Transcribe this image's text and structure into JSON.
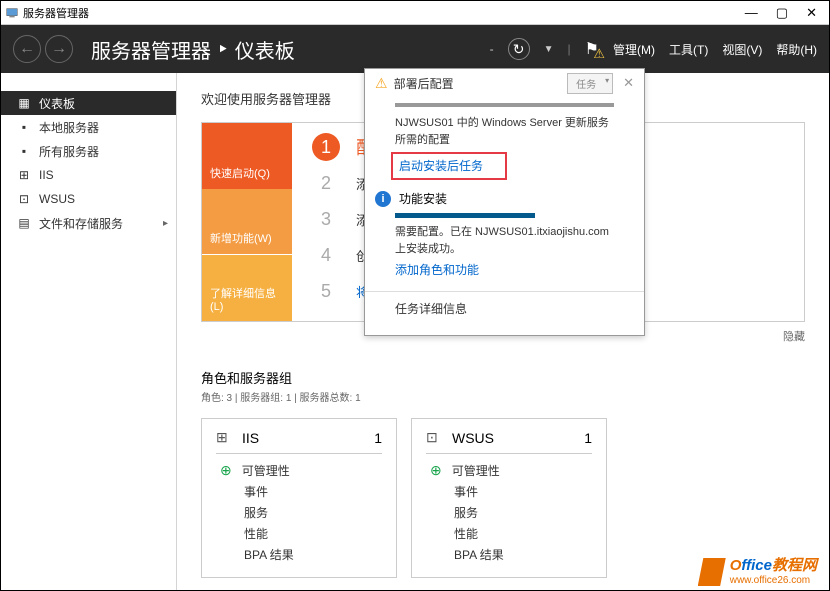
{
  "window": {
    "title": "服务器管理器"
  },
  "header": {
    "title_main": "服务器管理器",
    "title_sep": "‣",
    "title_sub": "仪表板",
    "menu": {
      "manage": "管理(M)",
      "tools": "工具(T)",
      "view": "视图(V)",
      "help": "帮助(H)"
    }
  },
  "sidebar": {
    "items": [
      {
        "icon": "dashboard",
        "label": "仪表板"
      },
      {
        "icon": "server",
        "label": "本地服务器"
      },
      {
        "icon": "servers",
        "label": "所有服务器"
      },
      {
        "icon": "iis",
        "label": "IIS"
      },
      {
        "icon": "wsus",
        "label": "WSUS"
      },
      {
        "icon": "files",
        "label": "文件和存储服务"
      }
    ]
  },
  "content": {
    "welcome": "欢迎使用服务器管理器",
    "qs_tabs": {
      "quick": "快速启动(Q)",
      "new": "新增功能(W)",
      "learn": "了解详细信息(L)"
    },
    "steps": {
      "s1": "配",
      "s2": "添",
      "s3": "添",
      "s4": "创",
      "s5": "将此服务器连接到云服务"
    },
    "hide": "隐藏",
    "roles_title": "角色和服务器组",
    "roles_sub": "角色: 3 | 服务器组: 1 | 服务器总数: 1"
  },
  "tiles": [
    {
      "name": "IIS",
      "count": "1",
      "rows": [
        "可管理性",
        "事件",
        "服务",
        "性能",
        "BPA 结果"
      ]
    },
    {
      "name": "WSUS",
      "count": "1",
      "rows": [
        "可管理性",
        "事件",
        "服务",
        "性能",
        "BPA 结果"
      ]
    }
  ],
  "notif": {
    "title": "部署后配置",
    "task_label": "任务",
    "desc": "NJWSUS01 中的 Windows Server 更新服务 所需的配置",
    "link1": "启动安装后任务",
    "install_title": "功能安装",
    "install_desc": "需要配置。已在 NJWSUS01.itxiaojishu.com 上安装成功。",
    "link2": "添加角色和功能",
    "detail": "任务详细信息"
  },
  "watermark": {
    "text": "Office教程网",
    "url": "www.office26.com"
  }
}
